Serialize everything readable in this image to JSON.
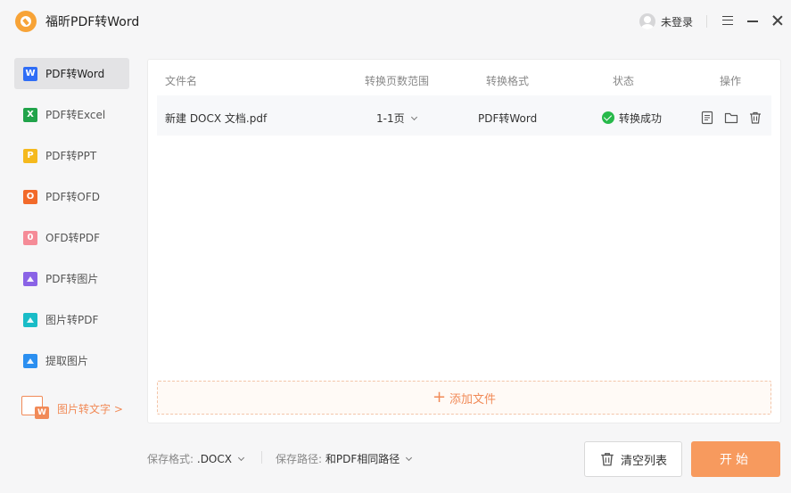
{
  "app": {
    "title": "福昕PDF转Word"
  },
  "user": {
    "login_label": "未登录"
  },
  "sidebar": {
    "items": [
      {
        "label": "PDF转Word",
        "icon_text": "W",
        "color": "#2f6df6",
        "icon": "word-icon",
        "active": true
      },
      {
        "label": "PDF转Excel",
        "icon_text": "X",
        "color": "#21a34a",
        "icon": "excel-icon",
        "active": false
      },
      {
        "label": "PDF转PPT",
        "icon_text": "P",
        "color": "#f5b91d",
        "icon": "ppt-icon",
        "active": false
      },
      {
        "label": "PDF转OFD",
        "icon_text": "O",
        "color": "#f26a2a",
        "icon": "ofd-icon",
        "active": false
      },
      {
        "label": "OFD转PDF",
        "icon_text": "0",
        "color": "#f58b97",
        "icon": "pdf-icon",
        "active": false
      },
      {
        "label": "PDF转图片",
        "icon_text": "",
        "color": "#8a63e6",
        "icon": "image-icon",
        "active": false
      },
      {
        "label": "图片转PDF",
        "icon_text": "",
        "color": "#19bcc7",
        "icon": "image-to-pdf-icon",
        "active": false
      },
      {
        "label": "提取图片",
        "icon_text": "",
        "color": "#2b8ff0",
        "icon": "extract-image-icon",
        "active": false
      }
    ],
    "promo_label": "图片转文字 >",
    "promo_icon_text": "W"
  },
  "table": {
    "headers": {
      "name": "文件名",
      "range": "转换页数范围",
      "format": "转换格式",
      "status": "状态",
      "actions": "操作"
    },
    "rows": [
      {
        "name": "新建 DOCX 文档.pdf",
        "range": "1-1页",
        "format": "PDF转Word",
        "status": "转换成功"
      }
    ],
    "add_file_label": "添加文件"
  },
  "footer": {
    "format_label": "保存格式:",
    "format_value": ".DOCX",
    "path_label": "保存路径:",
    "path_value": "和PDF相同路径",
    "clear_label": "清空列表",
    "start_label": "开始"
  },
  "colors": {
    "accent": "#f79a5e",
    "success": "#27b94a"
  }
}
